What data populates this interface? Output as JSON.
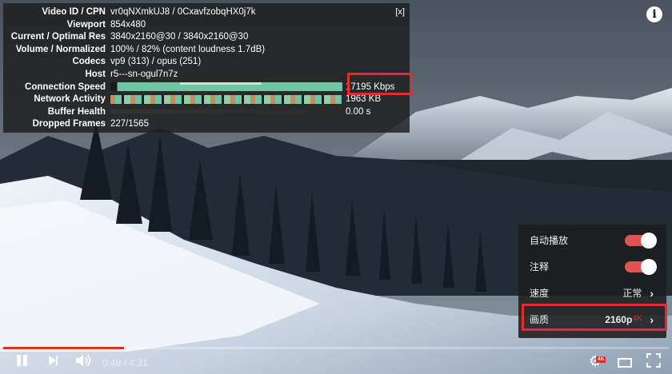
{
  "stats": {
    "close_label": "[x]",
    "rows": [
      {
        "label": "Video ID / CPN",
        "value": "vr0qNXmkUJ8 / 0CxavfzobqHX0j7k"
      },
      {
        "label": "Viewport",
        "value": "854x480"
      },
      {
        "label": "Current / Optimal Res",
        "value": "3840x2160@30 / 3840x2160@30"
      },
      {
        "label": "Volume / Normalized",
        "value": "100% / 82% (content loudness 1.7dB)"
      },
      {
        "label": "Codecs",
        "value": "vp9 (313) / opus (251)"
      },
      {
        "label": "Host",
        "value": "r5---sn-ogul7n7z"
      },
      {
        "label": "Connection Speed",
        "value": "17195 Kbps"
      },
      {
        "label": "Network Activity",
        "value": "1963 KB"
      },
      {
        "label": "Buffer Health",
        "value": "0.00 s"
      },
      {
        "label": "Dropped Frames",
        "value": "227/1565"
      }
    ]
  },
  "info_icon": "i",
  "settings_menu": {
    "items": [
      {
        "label": "自动播放",
        "type": "toggle",
        "on": true
      },
      {
        "label": "注释",
        "type": "toggle",
        "on": true
      },
      {
        "label": "速度",
        "type": "select",
        "value": "正常"
      },
      {
        "label": "画质",
        "type": "select",
        "value": "2160p",
        "badge": "4K"
      }
    ]
  },
  "player": {
    "progress_fraction": 0.181,
    "time_current": "0:49",
    "time_separator": "/",
    "time_total": "4:31",
    "quality_badge": "4K",
    "accent_color": "#e52d27"
  }
}
